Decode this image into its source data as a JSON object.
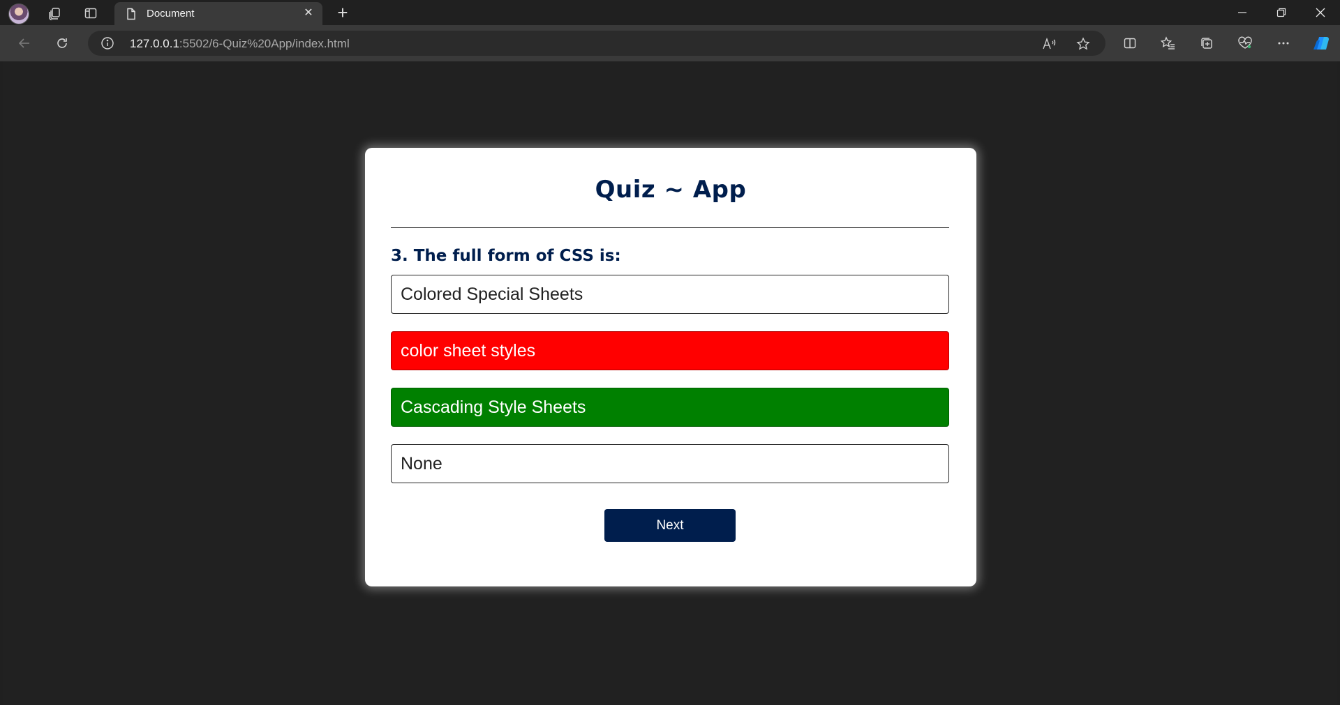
{
  "browser": {
    "tab": {
      "title": "Document",
      "close_symbol": "✕"
    },
    "new_tab_symbol": "+",
    "url": {
      "host": "127.0.0.1",
      "path": ":5502/6-Quiz%20App/index.html"
    }
  },
  "quiz": {
    "title": "Quiz ~ App",
    "question": "3. The full form of CSS is:",
    "answers": [
      {
        "text": "Colored Special Sheets",
        "state": "neutral"
      },
      {
        "text": "color sheet styles",
        "state": "incorrect"
      },
      {
        "text": "Cascading Style Sheets",
        "state": "correct"
      },
      {
        "text": "None",
        "state": "neutral"
      }
    ],
    "next_label": "Next"
  },
  "colors": {
    "primary": "#001e4d",
    "correct": "#008000",
    "incorrect": "#ff0000",
    "page_background": "#212121"
  }
}
